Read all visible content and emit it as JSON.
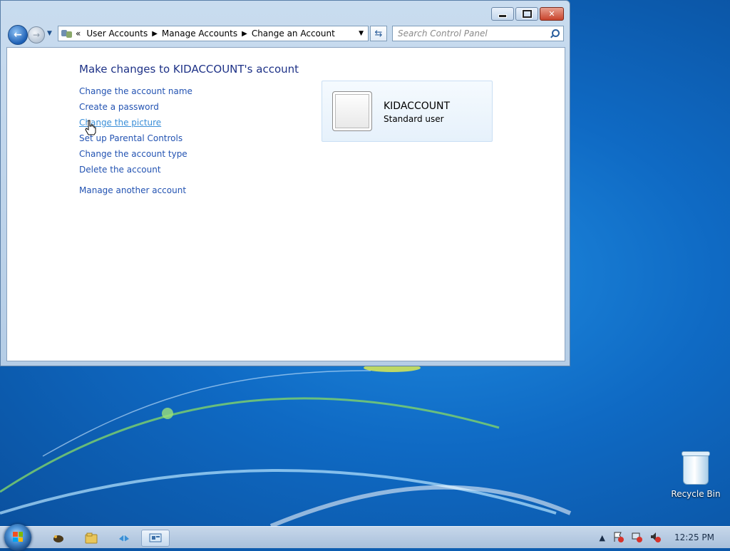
{
  "window": {
    "caption_buttons": {
      "minimize": "minimize",
      "maximize": "maximize",
      "close": "close"
    },
    "breadcrumb": {
      "overflow_glyph": "«",
      "items": [
        "User Accounts",
        "Manage Accounts",
        "Change an Account"
      ]
    },
    "search": {
      "placeholder": "Search Control Panel"
    },
    "content": {
      "title": "Make changes to KIDACCOUNT's account",
      "tasks": [
        "Change the account name",
        "Create a password",
        "Change the picture",
        "Set up Parental Controls",
        "Change the account type",
        "Delete the account"
      ],
      "other_task": "Manage another account",
      "account": {
        "name": "KIDACCOUNT",
        "type": "Standard user"
      }
    }
  },
  "desktop": {
    "icons": [
      {
        "label": "Recycle Bin",
        "icon": "recycle-bin-icon"
      }
    ]
  },
  "taskbar": {
    "pinned": [
      "media-player-icon",
      "explorer-icon",
      "network-icon",
      "control-panel-icon"
    ],
    "clock": "12:25 PM"
  },
  "colors": {
    "link": "#2353b2",
    "title": "#1e3287",
    "link_hover": "#3b8fd8"
  }
}
